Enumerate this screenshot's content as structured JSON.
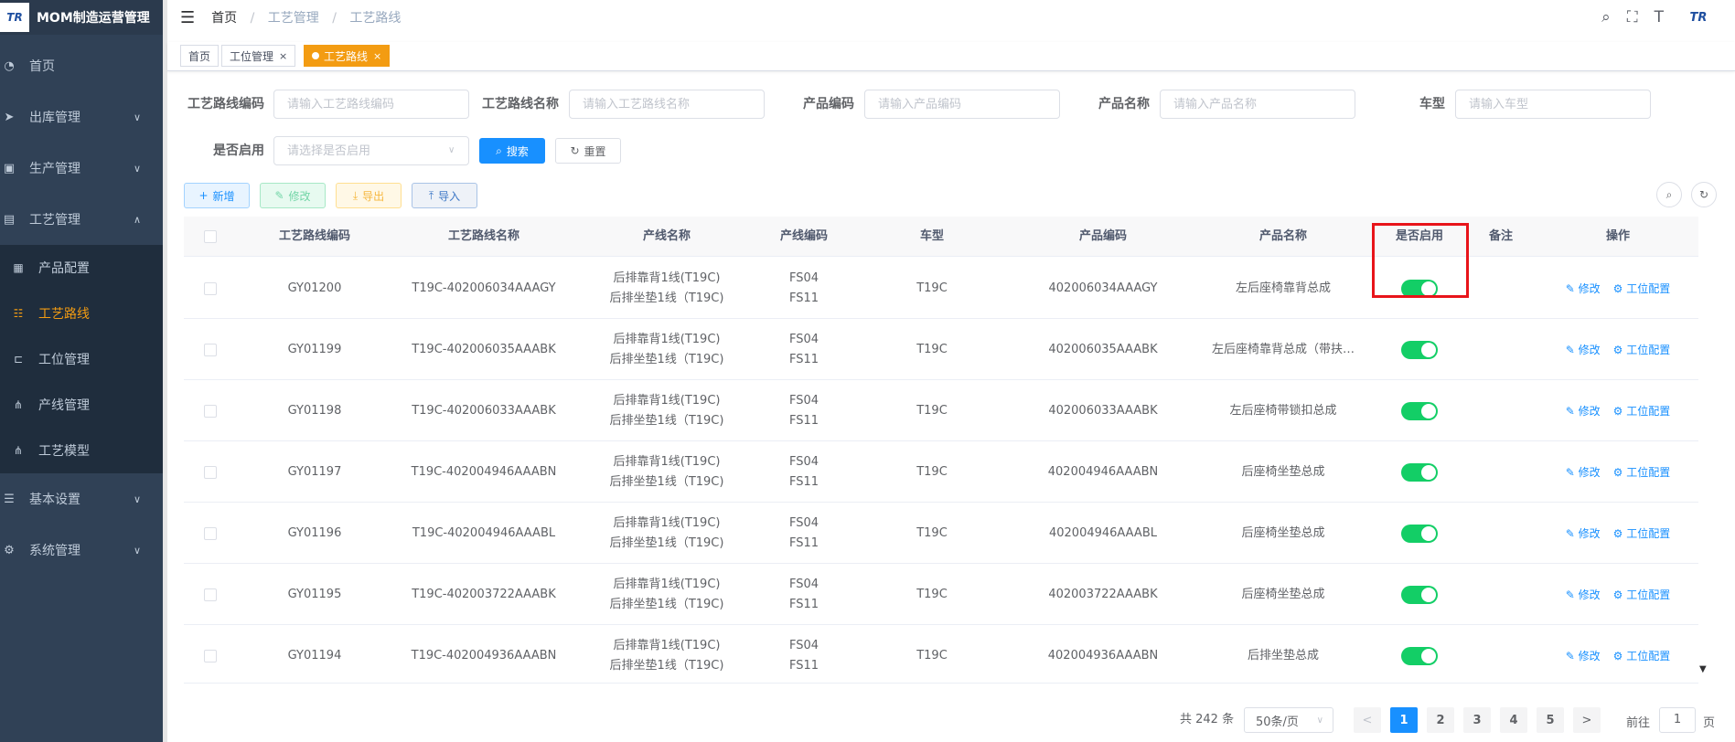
{
  "app": {
    "logo_text": "TR",
    "title": "MOM制造运营管理"
  },
  "sidebar": {
    "items": [
      {
        "label": "首页",
        "icon": "dashboard-icon",
        "chevron": ""
      },
      {
        "label": "出库管理",
        "icon": "send-icon",
        "chevron": "∨"
      },
      {
        "label": "生产管理",
        "icon": "production-icon",
        "chevron": "∨"
      },
      {
        "label": "工艺管理",
        "icon": "process-icon",
        "chevron": "∧"
      },
      {
        "label": "基本设置",
        "icon": "settings-sliders-icon",
        "chevron": "∨"
      },
      {
        "label": "系统管理",
        "icon": "gear-icon",
        "chevron": "∨"
      }
    ],
    "sub_items": [
      {
        "label": "产品配置",
        "icon": "product-icon"
      },
      {
        "label": "工艺路线",
        "icon": "route-icon"
      },
      {
        "label": "工位管理",
        "icon": "station-icon"
      },
      {
        "label": "产线管理",
        "icon": "tree-icon"
      },
      {
        "label": "工艺模型",
        "icon": "tree-icon"
      }
    ],
    "accent_color": "#f39c12"
  },
  "header": {
    "breadcrumb": [
      "首页",
      "工艺管理",
      "工艺路线"
    ],
    "separator": "/",
    "icons": [
      "search-icon",
      "fullscreen-icon",
      "font-size-icon"
    ],
    "avatar_text": "TR"
  },
  "tags": [
    {
      "label": "首页",
      "closable": false
    },
    {
      "label": "工位管理",
      "closable": true
    },
    {
      "label": "工艺路线",
      "closable": true,
      "active": true
    }
  ],
  "tag_close": "×",
  "search": {
    "fields": [
      {
        "label": "工艺路线编码",
        "placeholder": "请输入工艺路线编码"
      },
      {
        "label": "工艺路线名称",
        "placeholder": "请输入工艺路线名称"
      },
      {
        "label": "产品编码",
        "placeholder": "请输入产品编码"
      },
      {
        "label": "产品名称",
        "placeholder": "请输入产品名称"
      },
      {
        "label": "车型",
        "placeholder": "请输入车型"
      }
    ],
    "enabled_label": "是否启用",
    "enabled_placeholder": "请选择是否启用",
    "search_btn": "搜索",
    "reset_btn": "重置"
  },
  "toolbar": {
    "add": "新增",
    "edit": "修改",
    "export": "导出",
    "import": "导入"
  },
  "table": {
    "columns": [
      "工艺路线编码",
      "工艺路线名称",
      "产线名称",
      "产线编码",
      "车型",
      "产品编码",
      "产品名称",
      "是否启用",
      "备注",
      "操作"
    ],
    "op_edit": "修改",
    "op_station": "工位配置",
    "rows": [
      {
        "code": "GY01200",
        "name": "T19C-402006034AAAGY",
        "lines": [
          "后排靠背1线(T19C)",
          "后排坐垫1线（T19C)"
        ],
        "line_codes": [
          "FS04",
          "FS11"
        ],
        "model": "T19C",
        "product_code": "402006034AAAGY",
        "product_name": "左后座椅靠背总成",
        "enabled": true,
        "remark": ""
      },
      {
        "code": "GY01199",
        "name": "T19C-402006035AAABK",
        "lines": [
          "后排靠背1线(T19C)",
          "后排坐垫1线（T19C)"
        ],
        "line_codes": [
          "FS04",
          "FS11"
        ],
        "model": "T19C",
        "product_code": "402006035AAABK",
        "product_name": "左后座椅靠背总成（带扶…",
        "enabled": true,
        "remark": ""
      },
      {
        "code": "GY01198",
        "name": "T19C-402006033AAABK",
        "lines": [
          "后排靠背1线(T19C)",
          "后排坐垫1线（T19C)"
        ],
        "line_codes": [
          "FS04",
          "FS11"
        ],
        "model": "T19C",
        "product_code": "402006033AAABK",
        "product_name": "左后座椅带锁扣总成",
        "enabled": true,
        "remark": ""
      },
      {
        "code": "GY01197",
        "name": "T19C-402004946AAABN",
        "lines": [
          "后排靠背1线(T19C)",
          "后排坐垫1线（T19C)"
        ],
        "line_codes": [
          "FS04",
          "FS11"
        ],
        "model": "T19C",
        "product_code": "402004946AAABN",
        "product_name": "后座椅坐垫总成",
        "enabled": true,
        "remark": ""
      },
      {
        "code": "GY01196",
        "name": "T19C-402004946AAABL",
        "lines": [
          "后排靠背1线(T19C)",
          "后排坐垫1线（T19C)"
        ],
        "line_codes": [
          "FS04",
          "FS11"
        ],
        "model": "T19C",
        "product_code": "402004946AAABL",
        "product_name": "后座椅坐垫总成",
        "enabled": true,
        "remark": ""
      },
      {
        "code": "GY01195",
        "name": "T19C-402003722AAABK",
        "lines": [
          "后排靠背1线(T19C)",
          "后排坐垫1线（T19C)"
        ],
        "line_codes": [
          "FS04",
          "FS11"
        ],
        "model": "T19C",
        "product_code": "402003722AAABK",
        "product_name": "后座椅坐垫总成",
        "enabled": true,
        "remark": ""
      },
      {
        "code": "GY01194",
        "name": "T19C-402004936AAABN",
        "lines": [
          "后排靠背1线(T19C)",
          "后排坐垫1线（T19C)"
        ],
        "line_codes": [
          "FS04",
          "FS11"
        ],
        "model": "T19C",
        "product_code": "402004936AAABN",
        "product_name": "后排坐垫总成",
        "enabled": true,
        "remark": ""
      }
    ],
    "switch_on_color": "#13ce66"
  },
  "pagination": {
    "total": "共 242 条",
    "page_size": "50条/页",
    "pages": [
      "1",
      "2",
      "3",
      "4",
      "5"
    ],
    "current": "1",
    "prev": "<",
    "next": ">",
    "goto_label": "前往",
    "goto_value": "1",
    "goto_unit": "页"
  }
}
